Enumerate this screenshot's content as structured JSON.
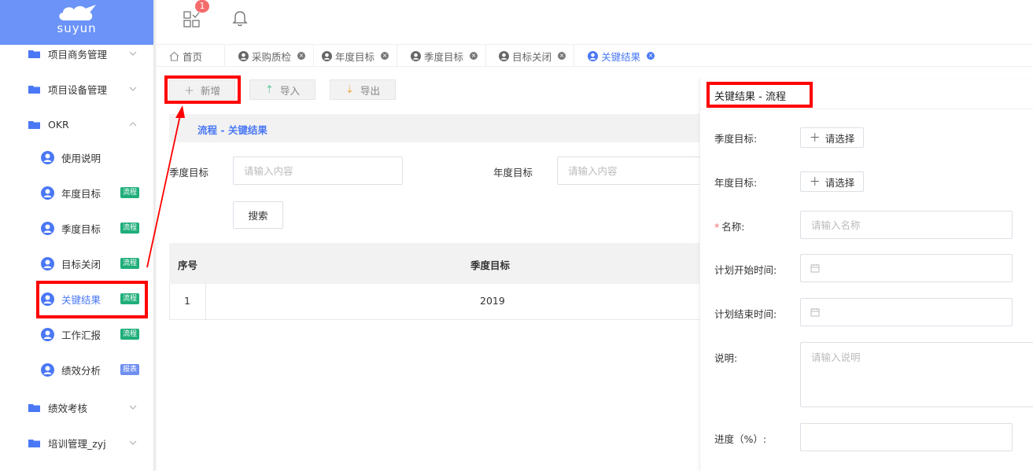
{
  "logo": {
    "text": "suyun"
  },
  "topbar": {
    "badge_count": "1"
  },
  "sidebar": {
    "groups": [
      {
        "label": "项目商务管理"
      },
      {
        "label": "项目设备管理"
      },
      {
        "label": "OKR"
      },
      {
        "label": "绩效考核"
      },
      {
        "label": "培训管理_zyj"
      }
    ],
    "okr_items": [
      {
        "label": "使用说明",
        "tag": ""
      },
      {
        "label": "年度目标",
        "tag": "流程"
      },
      {
        "label": "季度目标",
        "tag": "流程"
      },
      {
        "label": "目标关闭",
        "tag": "流程"
      },
      {
        "label": "关键结果",
        "tag": "流程"
      },
      {
        "label": "工作汇报",
        "tag": "流程"
      },
      {
        "label": "绩效分析",
        "tag": "报表"
      }
    ],
    "colors": {
      "tag_flow": "#1fae7a",
      "tag_report": "#6f8ff0",
      "active": "#4a78f5"
    }
  },
  "tabs": [
    {
      "label": "首页"
    },
    {
      "label": "采购质检"
    },
    {
      "label": "年度目标"
    },
    {
      "label": "季度目标"
    },
    {
      "label": "目标关闭"
    },
    {
      "label": "关键结果"
    }
  ],
  "toolbar": {
    "add_label": "新增",
    "import_label": "导入",
    "export_label": "导出"
  },
  "flow_title": "流程 - 关键结果",
  "filters": {
    "quarter_label": "季度目标",
    "quarter_placeholder": "请输入内容",
    "year_label": "年度目标",
    "year_placeholder": "请输入内容",
    "search_label": "搜索"
  },
  "table": {
    "headers": [
      "序号",
      "季度目标"
    ],
    "rows": [
      {
        "index": "1",
        "quarter": "2019"
      }
    ]
  },
  "panel": {
    "title": "关键结果 - 流程",
    "quarter_label": "季度目标:",
    "year_label": "年度目标:",
    "pick_label": "请选择",
    "name_label": "名称:",
    "name_placeholder": "请输入名称",
    "start_label": "计划开始时间:",
    "end_label": "计划结束时间:",
    "desc_label": "说明:",
    "desc_placeholder": "请输入说明",
    "progress_label": "进度（%）:"
  }
}
